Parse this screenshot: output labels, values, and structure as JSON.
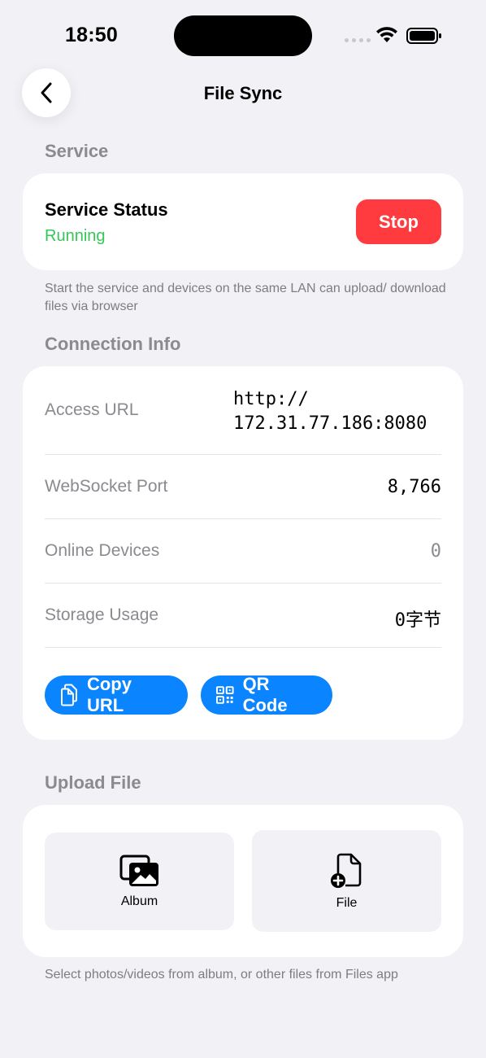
{
  "status_bar": {
    "time": "18:50"
  },
  "nav": {
    "title": "File Sync"
  },
  "service": {
    "header": "Service",
    "status_title": "Service Status",
    "status_value": "Running",
    "stop_label": "Stop",
    "footnote": "Start the service and devices on the same LAN can upload/ download files via browser"
  },
  "connection": {
    "header": "Connection Info",
    "rows": [
      {
        "label": "Access URL",
        "value_line1": "http://",
        "value_line2": "172.31.77.186:8080"
      },
      {
        "label": "WebSocket Port",
        "value": "8,766"
      },
      {
        "label": "Online Devices",
        "value": "0"
      },
      {
        "label": "Storage Usage",
        "value": "0字节"
      }
    ],
    "copy_url_label": "Copy URL",
    "qr_code_label": "QR Code"
  },
  "upload": {
    "header": "Upload File",
    "album_label": "Album",
    "file_label": "File",
    "footnote": "Select photos/videos from album, or other files from Files app"
  },
  "colors": {
    "accent": "#0A84FF",
    "stop": "#FF3B3F",
    "running": "#34C759",
    "background": "#F1F1F6"
  }
}
